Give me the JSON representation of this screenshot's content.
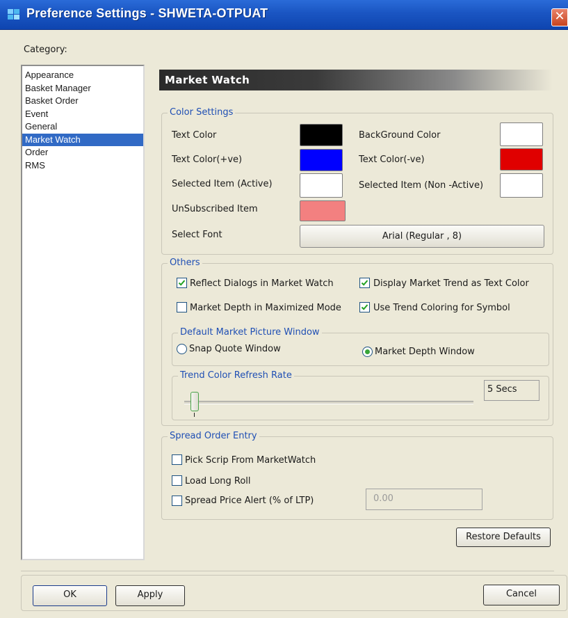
{
  "window": {
    "title": "Preference Settings - SHWETA-OTPUAT",
    "close_glyph": "✕"
  },
  "category": {
    "label": "Category:",
    "items": [
      "Appearance",
      "Basket Manager",
      "Basket Order",
      "Event",
      "General",
      "Market Watch",
      "Order",
      "RMS"
    ],
    "selected": "Market Watch"
  },
  "panel": {
    "title": "Market Watch"
  },
  "color_settings": {
    "title": "Color Settings",
    "text_color": {
      "label": "Text Color",
      "color": "#000000"
    },
    "background_color": {
      "label": "BackGround Color",
      "color": "#ffffff"
    },
    "text_color_pos": {
      "label": "Text Color(+ve)",
      "color": "#0000ff"
    },
    "text_color_neg": {
      "label": "Text Color(-ve)",
      "color": "#e00000"
    },
    "selected_active": {
      "label": "Selected Item (Active)",
      "color": "#ffffff"
    },
    "selected_inactive": {
      "label": "Selected Item (Non -Active)",
      "color": "#ffffff"
    },
    "unsubscribed": {
      "label": "UnSubscribed Item",
      "color": "#f38080"
    },
    "select_font_label": "Select Font",
    "font_button": "Arial (Regular , 8)"
  },
  "others": {
    "title": "Others",
    "reflect_dialogs": {
      "label": "Reflect Dialogs in Market Watch",
      "checked": true
    },
    "display_trend": {
      "label": "Display Market Trend as Text Color",
      "checked": true
    },
    "market_depth_max": {
      "label": "Market Depth in Maximized Mode",
      "checked": false
    },
    "trend_symbol": {
      "label": "Use Trend Coloring for Symbol",
      "checked": true
    },
    "default_picture": {
      "title": "Default Market Picture Window",
      "snap_quote": {
        "label": "Snap Quote Window",
        "selected": false
      },
      "market_depth": {
        "label": "Market Depth Window",
        "selected": true
      }
    },
    "trend_refresh": {
      "title": "Trend Color Refresh Rate",
      "value": "5 Secs"
    }
  },
  "spread": {
    "title": "Spread Order Entry",
    "pick_scrip": {
      "label": "Pick Scrip From MarketWatch",
      "checked": false
    },
    "long_roll": {
      "label": "Load Long Roll",
      "checked": false
    },
    "price_alert": {
      "label": "Spread Price Alert (% of LTP)",
      "checked": false
    },
    "price_value": "0.00"
  },
  "buttons": {
    "restore": "Restore Defaults",
    "ok": "OK",
    "apply": "Apply",
    "cancel": "Cancel"
  }
}
